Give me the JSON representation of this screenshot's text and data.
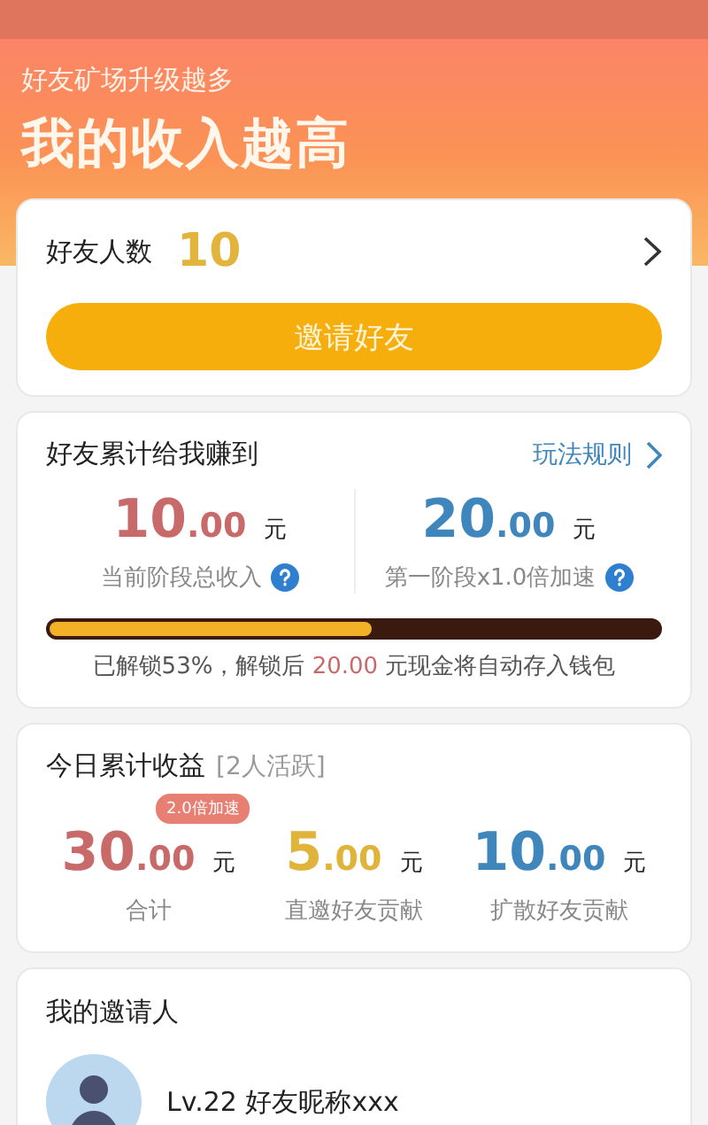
{
  "header": {
    "subtitle": "好友矿场升级越多",
    "title": "我的收入越高"
  },
  "friends": {
    "label": "好友人数",
    "count": "10",
    "button": "邀请好友"
  },
  "earned": {
    "title": "好友累计给我赚到",
    "rules_link": "玩法规则",
    "stats": [
      {
        "integer": "10",
        "decimals": ".00",
        "unit": "元",
        "label": "当前阶段总收入",
        "color": "#c96a6a"
      },
      {
        "integer": "20",
        "decimals": ".00",
        "unit": "元",
        "label": "第一阶段x1.0倍加速",
        "color": "#3f86bd"
      }
    ],
    "progress": {
      "level": 0.53
    },
    "note": {
      "before": "已解锁53%，解锁后 ",
      "amount": "20.00",
      "after": " 元现金将自动存入钱包"
    }
  },
  "today": {
    "title": "今日累计收益",
    "active": "[2人活跃]",
    "badge": "2.0倍加速",
    "stats": [
      {
        "integer": "30",
        "decimals": ".00",
        "unit": "元",
        "label": "合计",
        "color": "#c96a6a"
      },
      {
        "integer": "5",
        "decimals": ".00",
        "unit": "元",
        "label": "直邀好友贡献",
        "color": "#e0b43a"
      },
      {
        "integer": "10",
        "decimals": ".00",
        "unit": "元",
        "label": "扩散好友贡献",
        "color": "#3f86bd"
      }
    ]
  },
  "inviter": {
    "title": "我的邀请人",
    "name": "Lv.22 好友昵称xxx"
  }
}
